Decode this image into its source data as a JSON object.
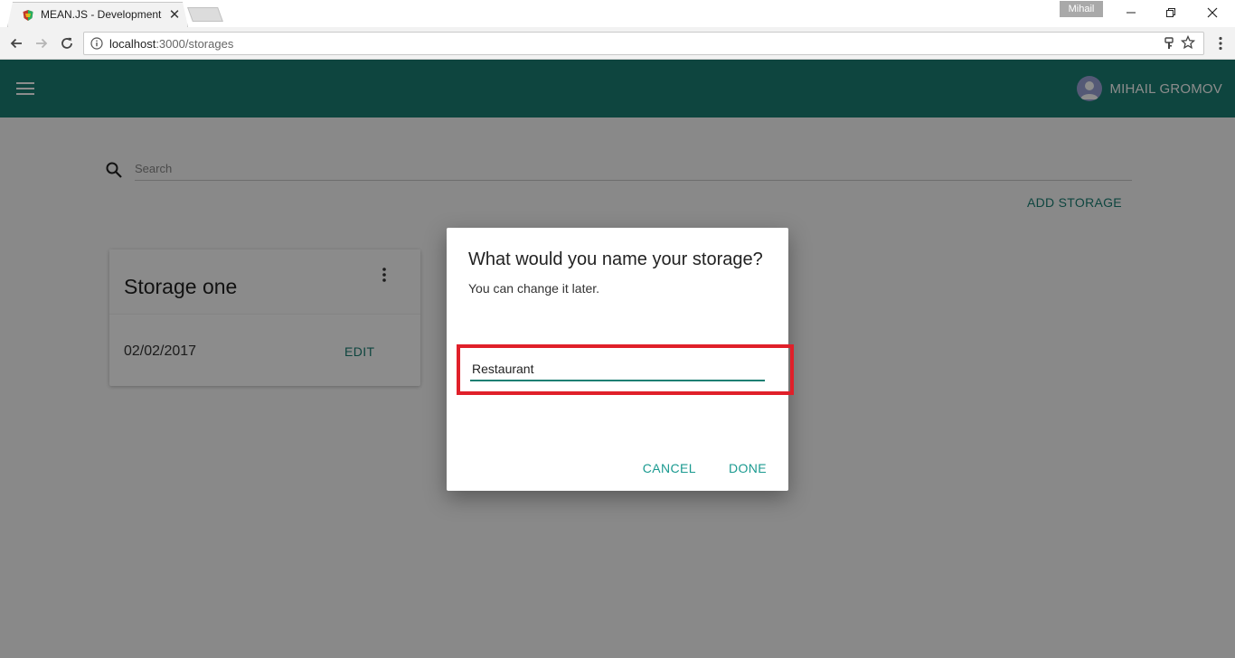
{
  "browser": {
    "tab_title": "MEAN.JS - Development",
    "tab_close": "✕",
    "profile_name": "Mihail",
    "url_host": "localhost",
    "url_path": ":3000/storages"
  },
  "app": {
    "user_name": "MIHAIL GROMOV",
    "search_placeholder": "Search",
    "add_storage_label": "ADD STORAGE",
    "accent_color": "#1a7f73",
    "storages": [
      {
        "title": "Storage one",
        "date": "02/02/2017",
        "edit_label": "EDIT"
      }
    ]
  },
  "dialog": {
    "title": "What would you name your storage?",
    "subtitle": "You can change it later.",
    "input_value": "Restaurant",
    "cancel_label": "CANCEL",
    "done_label": "DONE",
    "highlight_color": "#e0202a"
  }
}
